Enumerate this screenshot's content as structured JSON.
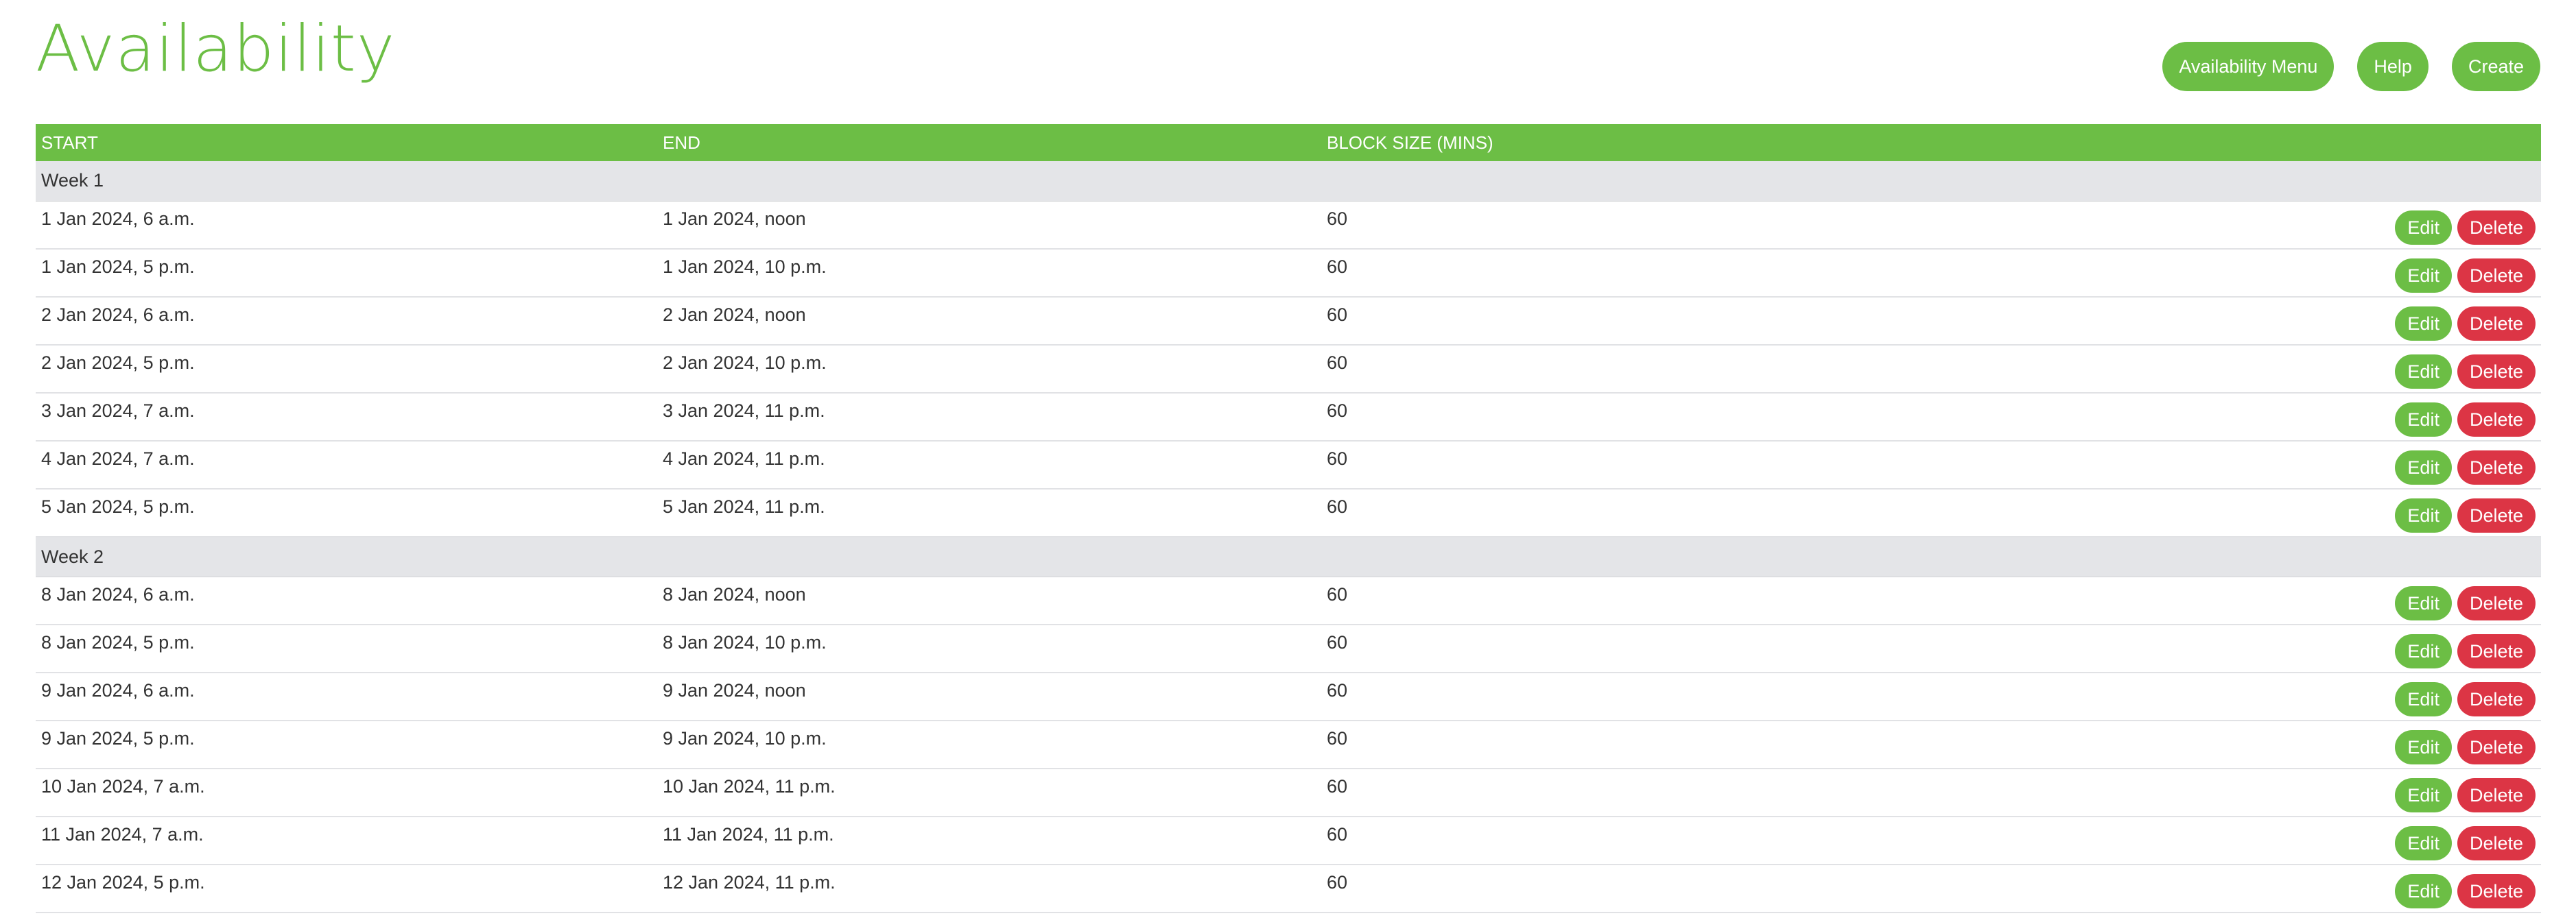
{
  "page": {
    "title": "Availability"
  },
  "toolbar": {
    "availability_menu": "Availability Menu",
    "help": "Help",
    "create": "Create"
  },
  "table": {
    "headers": {
      "start": "START",
      "end": "END",
      "block": "BLOCK SIZE (MINS)"
    },
    "edit_label": "Edit",
    "delete_label": "Delete",
    "groups": [
      {
        "label": "Week 1",
        "rows": [
          {
            "start": "1 Jan 2024, 6 a.m.",
            "end": "1 Jan 2024, noon",
            "block": "60"
          },
          {
            "start": "1 Jan 2024, 5 p.m.",
            "end": "1 Jan 2024, 10 p.m.",
            "block": "60"
          },
          {
            "start": "2 Jan 2024, 6 a.m.",
            "end": "2 Jan 2024, noon",
            "block": "60"
          },
          {
            "start": "2 Jan 2024, 5 p.m.",
            "end": "2 Jan 2024, 10 p.m.",
            "block": "60"
          },
          {
            "start": "3 Jan 2024, 7 a.m.",
            "end": "3 Jan 2024, 11 p.m.",
            "block": "60"
          },
          {
            "start": "4 Jan 2024, 7 a.m.",
            "end": "4 Jan 2024, 11 p.m.",
            "block": "60"
          },
          {
            "start": "5 Jan 2024, 5 p.m.",
            "end": "5 Jan 2024, 11 p.m.",
            "block": "60"
          }
        ]
      },
      {
        "label": "Week 2",
        "rows": [
          {
            "start": "8 Jan 2024, 6 a.m.",
            "end": "8 Jan 2024, noon",
            "block": "60"
          },
          {
            "start": "8 Jan 2024, 5 p.m.",
            "end": "8 Jan 2024, 10 p.m.",
            "block": "60"
          },
          {
            "start": "9 Jan 2024, 6 a.m.",
            "end": "9 Jan 2024, noon",
            "block": "60"
          },
          {
            "start": "9 Jan 2024, 5 p.m.",
            "end": "9 Jan 2024, 10 p.m.",
            "block": "60"
          },
          {
            "start": "10 Jan 2024, 7 a.m.",
            "end": "10 Jan 2024, 11 p.m.",
            "block": "60"
          },
          {
            "start": "11 Jan 2024, 7 a.m.",
            "end": "11 Jan 2024, 11 p.m.",
            "block": "60"
          },
          {
            "start": "12 Jan 2024, 5 p.m.",
            "end": "12 Jan 2024, 11 p.m.",
            "block": "60"
          }
        ]
      }
    ]
  },
  "colors": {
    "accent": "#6cbe45",
    "danger": "#dc3545",
    "group_bg": "#e4e5e8"
  }
}
